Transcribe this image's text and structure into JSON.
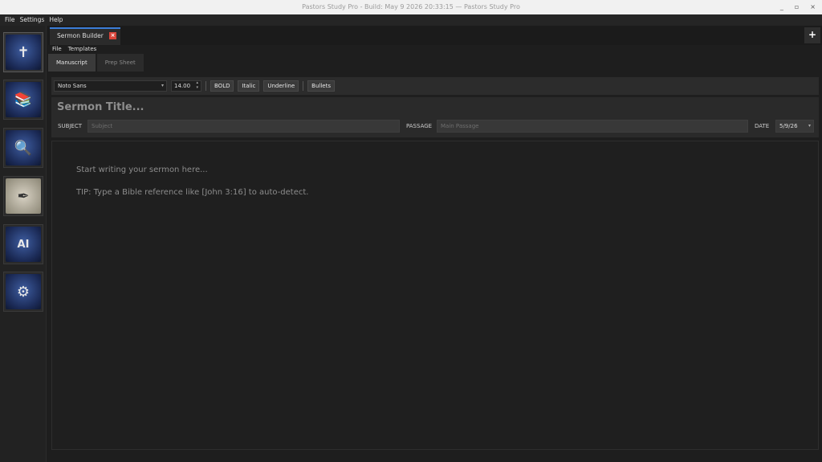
{
  "window": {
    "title": "Pastors Study Pro - Build: May  9 2026 20:33:15 — Pastors Study Pro",
    "controls": [
      "_",
      "▫",
      "×"
    ]
  },
  "menubar": [
    "File",
    "Settings",
    "Help"
  ],
  "sidebar": {
    "items": [
      {
        "name": "bible",
        "icon": "bible-icon",
        "glyph": "✝"
      },
      {
        "name": "library",
        "icon": "books-icon",
        "glyph": "📚"
      },
      {
        "name": "search",
        "icon": "magnifier-icon",
        "glyph": "🔍"
      },
      {
        "name": "sermon",
        "icon": "scroll-quill-icon",
        "glyph": "✒"
      },
      {
        "name": "ai",
        "icon": "ai-icon",
        "glyph": "AI"
      },
      {
        "name": "settings",
        "icon": "gears-icon",
        "glyph": "⚙"
      }
    ]
  },
  "tabs": {
    "active": "Sermon Builder",
    "close_glyph": "×",
    "add_glyph": "+"
  },
  "submenu": [
    "File",
    "Templates"
  ],
  "subtabs": [
    "Manuscript",
    "Prep Sheet"
  ],
  "toolbar": {
    "font": "Noto Sans",
    "size": "14.00",
    "bold": "BOLD",
    "italic": "Italic",
    "underline": "Underline",
    "bullets": "Bullets"
  },
  "header": {
    "title_placeholder": "Sermon Title...",
    "subject_label": "SUBJECT",
    "subject_placeholder": "Subject",
    "passage_label": "PASSAGE",
    "passage_placeholder": "Main Passage",
    "date_label": "DATE",
    "date_value": "5/9/26"
  },
  "editor": {
    "line1": "Start writing your sermon here...",
    "line2": "TIP: Type a Bible reference like [John 3:16] to auto-detect."
  }
}
